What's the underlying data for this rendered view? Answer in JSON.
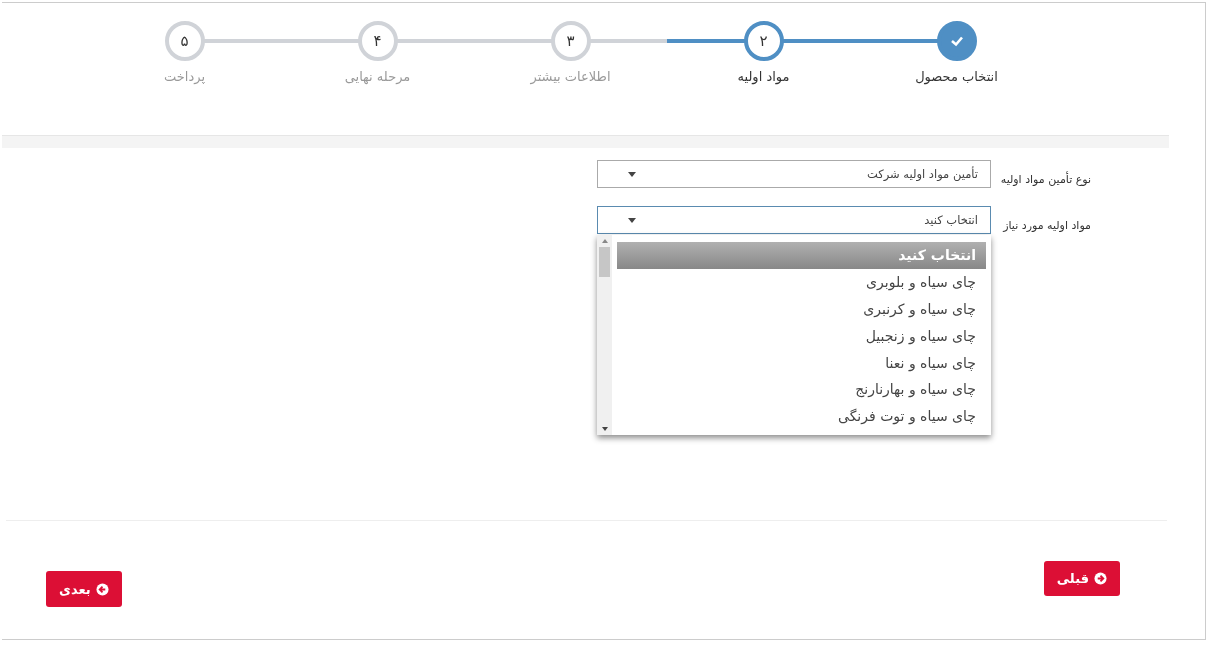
{
  "steps": [
    {
      "label": "انتخاب محصول",
      "completed": true,
      "selected": false
    },
    {
      "number": "۲",
      "label": "مواد اولیه",
      "completed": false,
      "selected": true
    },
    {
      "number": "۳",
      "label": "اطلاعات بیشتر",
      "completed": false,
      "selected": false
    },
    {
      "number": "۴",
      "label": "مرحله نهایی",
      "completed": false,
      "selected": false
    },
    {
      "number": "۵",
      "label": "پرداخت",
      "completed": false,
      "selected": false
    }
  ],
  "fields": [
    {
      "label": "نوع تأمین مواد اولیه",
      "value": "تأمین مواد اولیه شرکت",
      "expanded": false
    },
    {
      "label": "مواد اولیه مورد نیاز",
      "value": "انتخاب کنید",
      "expanded": true,
      "options": [
        {
          "label": "انتخاب کنید",
          "selected": true
        },
        {
          "label": "چای سیاه و بلوبری",
          "selected": false
        },
        {
          "label": "چای سیاه و کرنبری",
          "selected": false
        },
        {
          "label": "چای سیاه و زنجبیل",
          "selected": false
        },
        {
          "label": "چای سیاه و نعنا",
          "selected": false
        },
        {
          "label": "چای سیاه و بهارنارنج",
          "selected": false
        },
        {
          "label": "چای سیاه و توت فرنگی",
          "selected": false
        }
      ]
    }
  ],
  "buttons": {
    "previous": "قبلی",
    "next": "بعدی"
  }
}
